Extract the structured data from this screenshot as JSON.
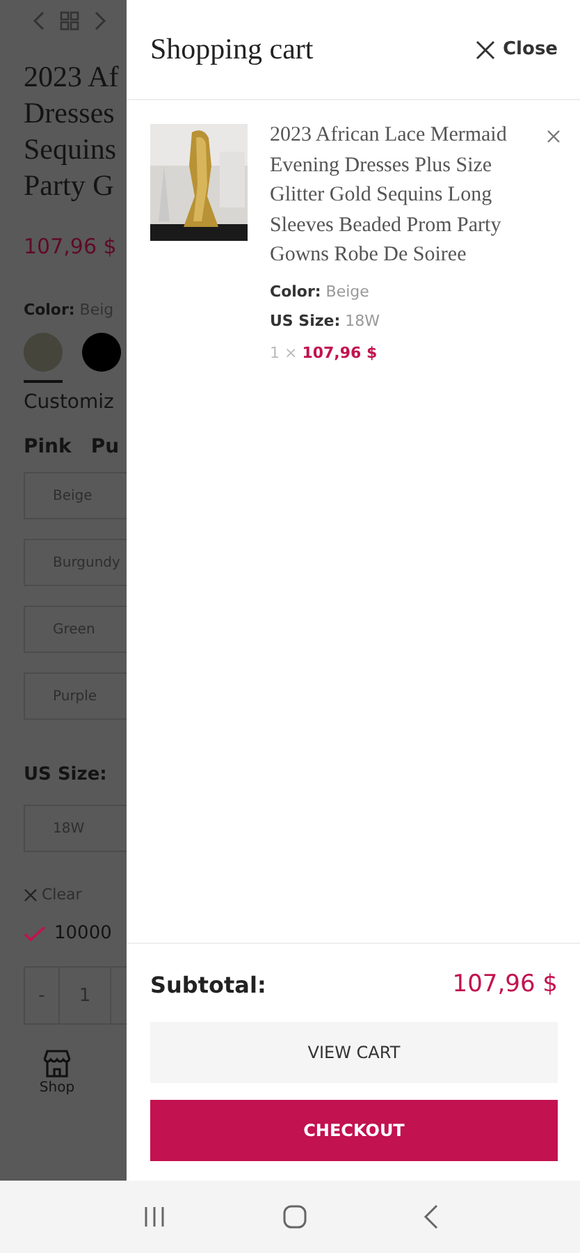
{
  "background_page": {
    "title_lines": [
      "2023 Af",
      "Dresses",
      "Sequins",
      "Party G"
    ],
    "price": "107,96 $",
    "color_label": "Color:",
    "color_value": "Beig",
    "swatches": [
      {
        "color": "#45453c",
        "selected": true
      },
      {
        "color": "#000000",
        "selected": false
      }
    ],
    "customize_label": "Customiz",
    "tabs": [
      {
        "label": "Pink"
      },
      {
        "label": "Pu"
      }
    ],
    "options": [
      "Beige",
      "Burgundy",
      "Green",
      "Purple"
    ],
    "size_label": "US Size:",
    "size_option": "18W",
    "clear": "Clear",
    "stock": "10000",
    "quantity": {
      "minus": "-",
      "value": "1"
    },
    "bottom_tab": "Shop"
  },
  "cart": {
    "title": "Shopping cart",
    "close": "Close",
    "items": [
      {
        "title": "2023 African Lace Mermaid Evening Dresses Plus Size Glitter Gold Sequins Long Sleeves Beaded Prom Party Gowns Robe De Soiree",
        "attributes": [
          {
            "label": "Color:",
            "value": "Beige"
          },
          {
            "label": "US Size:",
            "value": "18W"
          }
        ],
        "quantity": "1 ×",
        "price": "107,96 $"
      }
    ],
    "subtotal_label": "Subtotal:",
    "subtotal": "107,96 $",
    "buttons": [
      {
        "label": "VIEW CART",
        "kind": "secondary"
      },
      {
        "label": "CHECKOUT",
        "kind": "primary"
      }
    ]
  }
}
